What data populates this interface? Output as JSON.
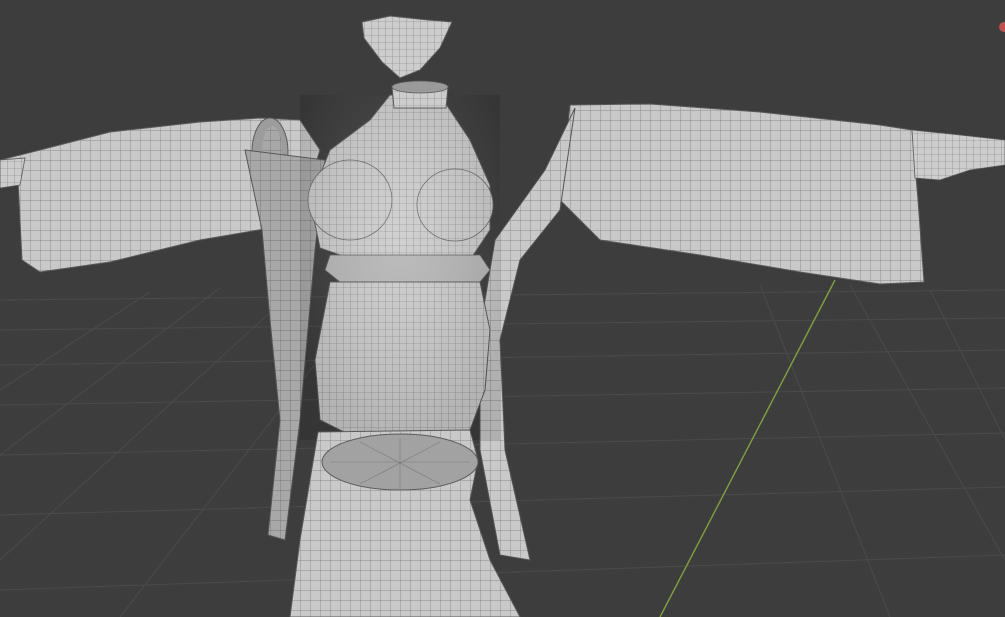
{
  "viewport": {
    "background_color": "#3d3d3d",
    "grid_line_color": "#4a4a4a",
    "y_axis_color": "#7ea23a",
    "mesh_fill_color": "#c8c8c8",
    "mesh_shade_color": "#a9a9a9",
    "mesh_wire_color": "#6e6e6e",
    "mesh_outline_color": "#5a5a5a"
  },
  "gizmo": {
    "x_axis_color": "#c05050"
  },
  "mesh": {
    "parts": [
      "collar",
      "neck",
      "torso",
      "jacket",
      "left-sleeve",
      "right-sleeve",
      "skirt"
    ]
  }
}
